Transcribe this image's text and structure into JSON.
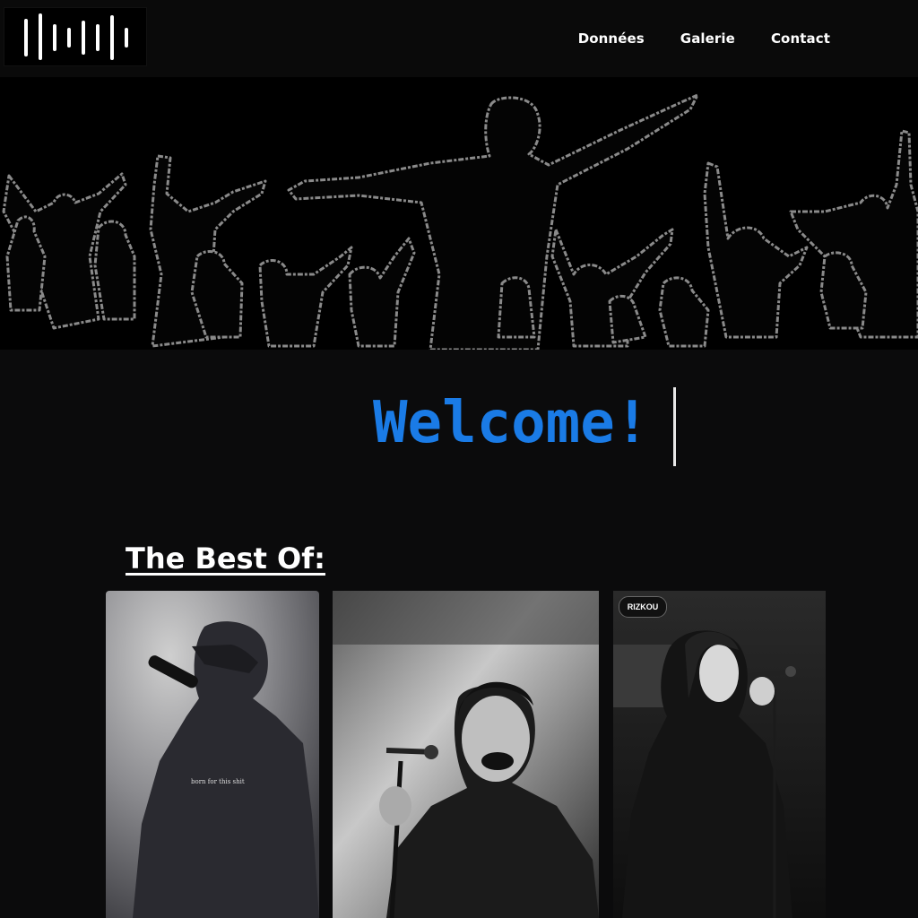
{
  "nav": {
    "logo_icon": "soundwave-icon",
    "links": [
      "Données",
      "Galerie",
      "Contact"
    ]
  },
  "hero": {
    "image": "concert-crowd-silhouette"
  },
  "welcome": {
    "text": "Welcome!",
    "color": "#1a7be6"
  },
  "best_of": {
    "title": "The Best Of:",
    "cards": [
      {
        "image": "rapper-with-microphone",
        "caption": "born for this shit"
      },
      {
        "image": "singer-laughing-at-microphone"
      },
      {
        "image": "female-singer-at-microphone",
        "badge": "RIZKOU"
      }
    ]
  }
}
